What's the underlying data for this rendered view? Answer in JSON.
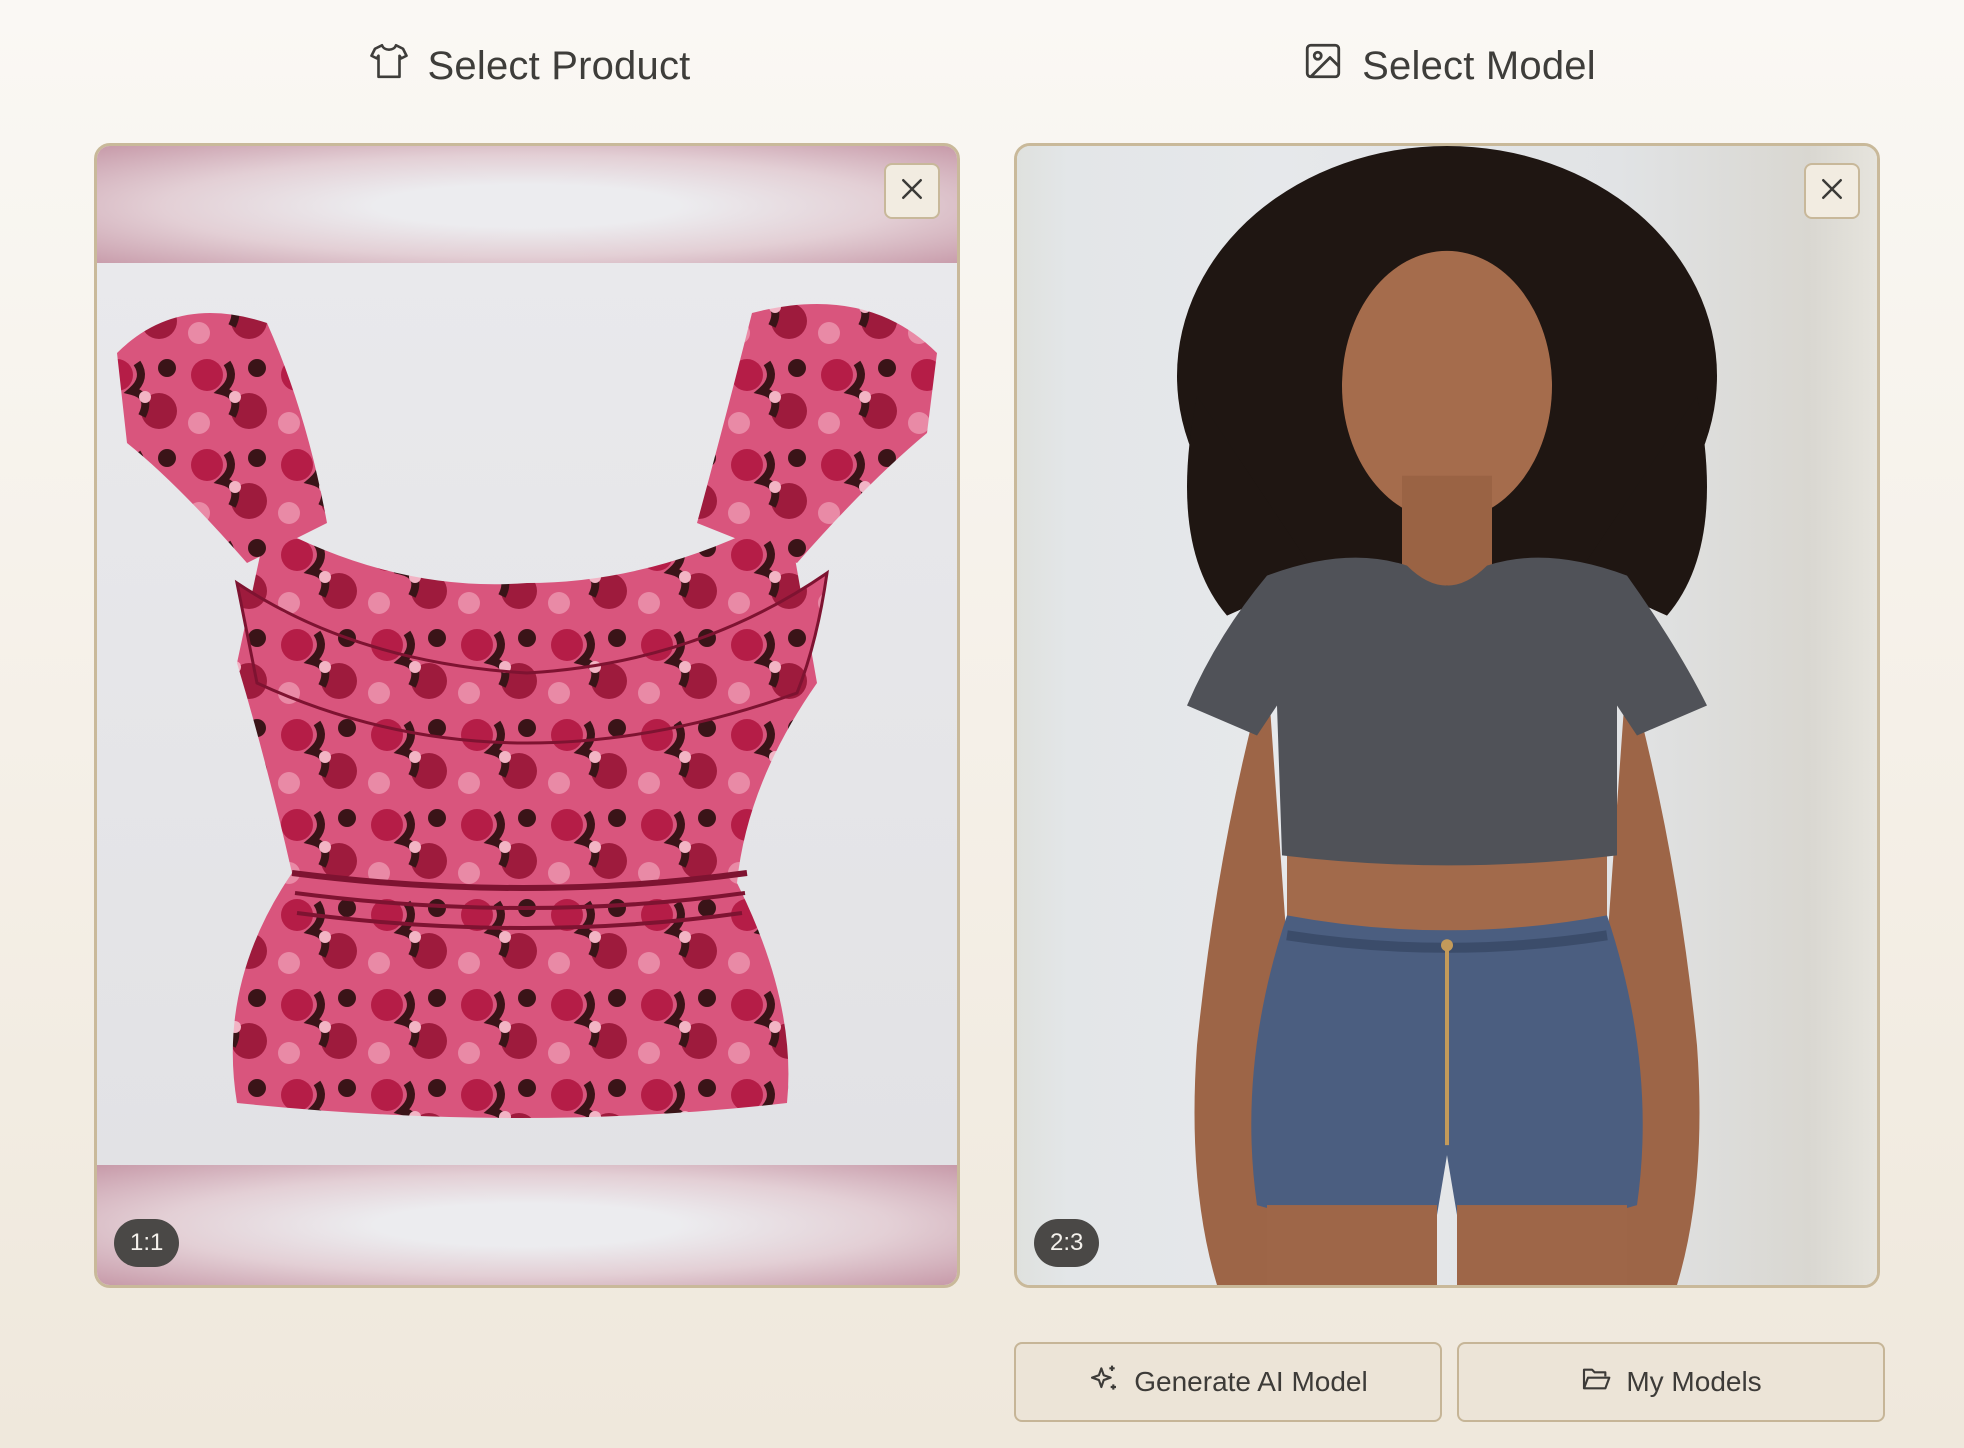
{
  "product": {
    "title": "Select Product",
    "title_icon": "tshirt-icon",
    "aspect_ratio": "1:1",
    "close_icon": "close-icon"
  },
  "model": {
    "title": "Select Model",
    "title_icon": "image-icon",
    "aspect_ratio": "2:3",
    "close_icon": "close-icon"
  },
  "actions": {
    "generate_label": "Generate AI Model",
    "generate_icon": "sparkles-icon",
    "mymodels_label": "My Models",
    "mymodels_icon": "folder-open-icon"
  },
  "colors": {
    "accent_border": "#c9b99a",
    "button_bg": "#ece4d7",
    "badge_bg": "#4a4846"
  }
}
